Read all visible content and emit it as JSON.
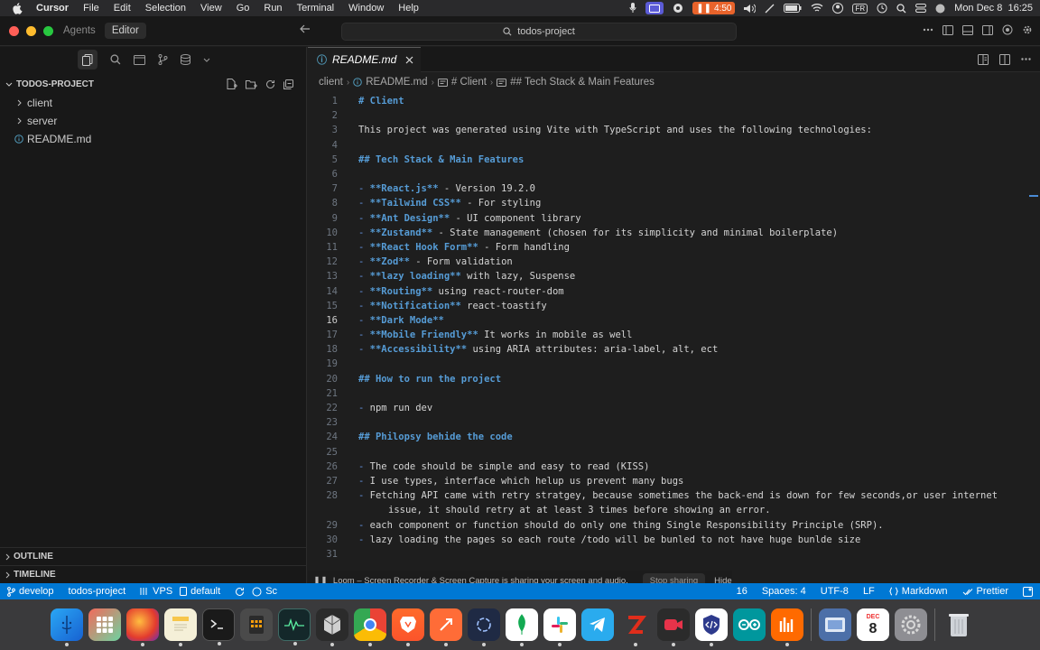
{
  "menubar": {
    "app_name": "Cursor",
    "items": [
      "File",
      "Edit",
      "Selection",
      "View",
      "Go",
      "Run",
      "Terminal",
      "Window",
      "Help"
    ],
    "timer": "4:50",
    "input_source": "FR",
    "datetime": "Mon Dec 8  16:25"
  },
  "titlebar": {
    "mode_tabs": [
      "Agents",
      "Editor"
    ],
    "search_text": "todos-project"
  },
  "sidebar": {
    "project_title": "TODOS-PROJECT",
    "tree": [
      {
        "label": "client",
        "type": "folder"
      },
      {
        "label": "server",
        "type": "folder"
      },
      {
        "label": "README.md",
        "type": "file"
      }
    ],
    "outline_label": "OUTLINE",
    "timeline_label": "TIMELINE"
  },
  "editor": {
    "tab_label": "README.md",
    "tab_icon": "ⓘ",
    "breadcrumb": [
      "client",
      "README.md",
      "# Client",
      "## Tech Stack & Main Features"
    ],
    "current_line": 16,
    "lines": [
      {
        "n": "1",
        "segs": [
          [
            "h1",
            "# Client"
          ]
        ]
      },
      {
        "n": "2",
        "segs": []
      },
      {
        "n": "3",
        "segs": [
          [
            "plain",
            "This project was generated using Vite with TypeScript and uses the following technologies:"
          ]
        ]
      },
      {
        "n": "4",
        "segs": []
      },
      {
        "n": "5",
        "segs": [
          [
            "h2",
            "## Tech Stack & Main Features"
          ]
        ]
      },
      {
        "n": "6",
        "segs": []
      },
      {
        "n": "7",
        "segs": [
          [
            "dash",
            "- "
          ],
          [
            "bold",
            "**React.js**"
          ],
          [
            "plain",
            " - Version 19.2.0"
          ]
        ]
      },
      {
        "n": "8",
        "segs": [
          [
            "dash",
            "- "
          ],
          [
            "bold",
            "**Tailwind CSS**"
          ],
          [
            "plain",
            " - For styling"
          ]
        ]
      },
      {
        "n": "9",
        "segs": [
          [
            "dash",
            "- "
          ],
          [
            "bold",
            "**Ant Design**"
          ],
          [
            "plain",
            " - UI component library"
          ]
        ]
      },
      {
        "n": "10",
        "segs": [
          [
            "dash",
            "- "
          ],
          [
            "bold",
            "**Zustand**"
          ],
          [
            "plain",
            " - State management (chosen for its simplicity and minimal boilerplate)"
          ]
        ]
      },
      {
        "n": "11",
        "segs": [
          [
            "dash",
            "- "
          ],
          [
            "bold",
            "**React Hook Form**"
          ],
          [
            "plain",
            " - Form handling"
          ]
        ]
      },
      {
        "n": "12",
        "segs": [
          [
            "dash",
            "- "
          ],
          [
            "bold",
            "**Zod**"
          ],
          [
            "plain",
            " - Form validation"
          ]
        ]
      },
      {
        "n": "13",
        "segs": [
          [
            "dash",
            "- "
          ],
          [
            "bold",
            "**lazy loading**"
          ],
          [
            "plain",
            " with lazy, Suspense"
          ]
        ]
      },
      {
        "n": "14",
        "segs": [
          [
            "dash",
            "- "
          ],
          [
            "bold",
            "**Routing**"
          ],
          [
            "plain",
            " using react-router-dom"
          ]
        ]
      },
      {
        "n": "15",
        "segs": [
          [
            "dash",
            "- "
          ],
          [
            "bold",
            "**Notification**"
          ],
          [
            "plain",
            " react-toastify"
          ]
        ]
      },
      {
        "n": "16",
        "segs": [
          [
            "dash",
            "- "
          ],
          [
            "bold",
            "**Dark Mode**"
          ]
        ]
      },
      {
        "n": "17",
        "segs": [
          [
            "dash",
            "- "
          ],
          [
            "bold",
            "**Mobile Friendly**"
          ],
          [
            "plain",
            " It works in mobile as well"
          ]
        ]
      },
      {
        "n": "18",
        "segs": [
          [
            "dash",
            "- "
          ],
          [
            "bold",
            "**Accessibility**"
          ],
          [
            "plain",
            " using ARIA attributes: aria-label, alt, ect"
          ]
        ]
      },
      {
        "n": "19",
        "segs": []
      },
      {
        "n": "20",
        "segs": [
          [
            "h2",
            "## How to run the project"
          ]
        ]
      },
      {
        "n": "21",
        "segs": []
      },
      {
        "n": "22",
        "segs": [
          [
            "dash",
            "- "
          ],
          [
            "plain",
            "npm run dev"
          ]
        ]
      },
      {
        "n": "23",
        "segs": []
      },
      {
        "n": "24",
        "segs": [
          [
            "h2",
            "## Philopsy behide the code"
          ]
        ]
      },
      {
        "n": "25",
        "segs": []
      },
      {
        "n": "26",
        "segs": [
          [
            "dash",
            "- "
          ],
          [
            "plain",
            "The code should be simple and easy to read (KISS)"
          ]
        ]
      },
      {
        "n": "27",
        "segs": [
          [
            "dash",
            "- "
          ],
          [
            "plain",
            "I use types, interface which helup us prevent many bugs"
          ]
        ]
      },
      {
        "n": "28",
        "segs": [
          [
            "dash",
            "- "
          ],
          [
            "plain",
            "Fetching API came with retry stratgey, because sometimes the back-end is down for few seconds,or user internet"
          ]
        ]
      },
      {
        "n": "",
        "segs": [
          [
            "plain",
            "issue, it should retry at at least 3 times before showing an error."
          ]
        ],
        "wrap": true
      },
      {
        "n": "29",
        "segs": [
          [
            "dash",
            "- "
          ],
          [
            "plain",
            "each component or function should do only one thing Single Responsibility Principle (SRP)."
          ]
        ]
      },
      {
        "n": "30",
        "segs": [
          [
            "dash",
            "- "
          ],
          [
            "plain",
            "lazy loading the pages so each route /todo will be bunled to not have huge bunlde size"
          ]
        ]
      },
      {
        "n": "31",
        "segs": []
      }
    ]
  },
  "loom": {
    "message": "Loom – Screen Recorder & Screen Capture is sharing your screen and audio.",
    "stop_label": "Stop sharing",
    "hide_label": "Hide"
  },
  "statusbar": {
    "branch": "develop",
    "project": "todos-project",
    "vps": "VPS",
    "profile": "default",
    "left_extra": "Sc",
    "col_fragment": "16",
    "spaces": "Spaces: 4",
    "encoding": "UTF-8",
    "eol": "LF",
    "language": "Markdown",
    "formatter": "Prettier"
  },
  "dock": {
    "calendar_month": "DEC",
    "calendar_day": "8"
  },
  "colors": {
    "accent": "#0078d4",
    "heading": "#569cd6",
    "background": "#1e1e1e"
  }
}
